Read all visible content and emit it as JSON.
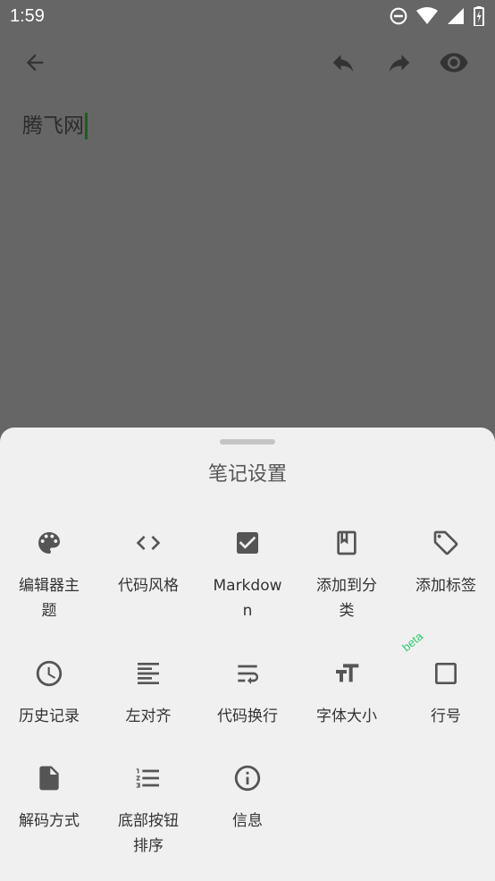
{
  "status_bar": {
    "time": "1:59"
  },
  "editor": {
    "text": "腾飞网"
  },
  "sheet": {
    "title": "笔记设置",
    "beta_badge": "beta",
    "items": [
      {
        "label": "编辑器主题",
        "icon": "palette-icon"
      },
      {
        "label": "代码风格",
        "icon": "code-icon"
      },
      {
        "label": "Markdown",
        "icon": "checkbox-checked-icon"
      },
      {
        "label": "添加到分类",
        "icon": "book-bookmark-icon"
      },
      {
        "label": "添加标签",
        "icon": "tag-icon"
      },
      {
        "label": "历史记录",
        "icon": "clock-icon"
      },
      {
        "label": "左对齐",
        "icon": "align-left-icon"
      },
      {
        "label": "代码换行",
        "icon": "wrap-text-icon"
      },
      {
        "label": "字体大小",
        "icon": "text-size-icon"
      },
      {
        "label": "行号",
        "icon": "checkbox-empty-icon"
      },
      {
        "label": "解码方式",
        "icon": "file-icon"
      },
      {
        "label": "底部按钮排序",
        "icon": "ordered-list-icon"
      },
      {
        "label": "信息",
        "icon": "info-icon"
      }
    ]
  },
  "colors": {
    "overlay": "#666666",
    "sheet_bg": "#f0f0f0",
    "icon": "#555555",
    "beta": "#2ecc71"
  }
}
